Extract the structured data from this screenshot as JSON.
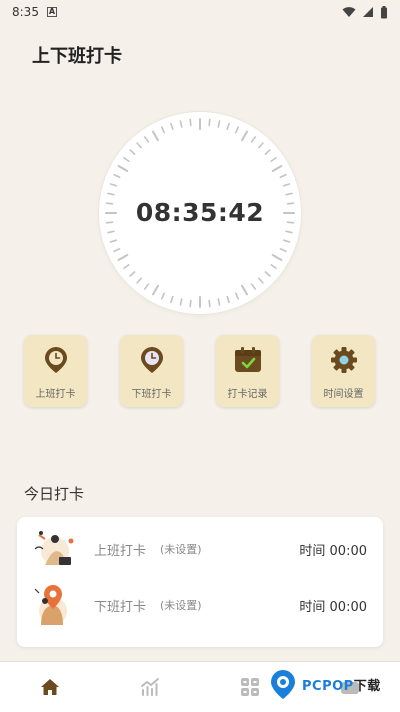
{
  "status_bar": {
    "time": "8:35",
    "indicator": "A"
  },
  "header": {
    "title": "上下班打卡"
  },
  "clock": {
    "time": "08:35:42"
  },
  "actions": [
    {
      "label": "上班打卡",
      "icon": "clock-pin-icon"
    },
    {
      "label": "下班打卡",
      "icon": "clock-pin-icon"
    },
    {
      "label": "打卡记录",
      "icon": "calendar-check-icon"
    },
    {
      "label": "时间设置",
      "icon": "gear-icon"
    }
  ],
  "today": {
    "title": "今日打卡",
    "records": [
      {
        "name": "上班打卡",
        "status": "(未设置)",
        "time": "时间 00:00"
      },
      {
        "name": "下班打卡",
        "status": "(未设置)",
        "time": "时间 00:00"
      }
    ]
  },
  "bottom_nav": [
    {
      "icon": "home-icon",
      "active": true
    },
    {
      "icon": "chart-icon",
      "active": false
    },
    {
      "icon": "grid-icon",
      "active": false
    },
    {
      "icon": "profile-icon",
      "active": false
    }
  ],
  "watermark": {
    "prefix": "PCPOP",
    "suffix": "下载"
  },
  "colors": {
    "background": "#f5f0ea",
    "card": "#f3e6c3",
    "icon_brown": "#6b4a1f",
    "accent_orange": "#e8733a"
  }
}
